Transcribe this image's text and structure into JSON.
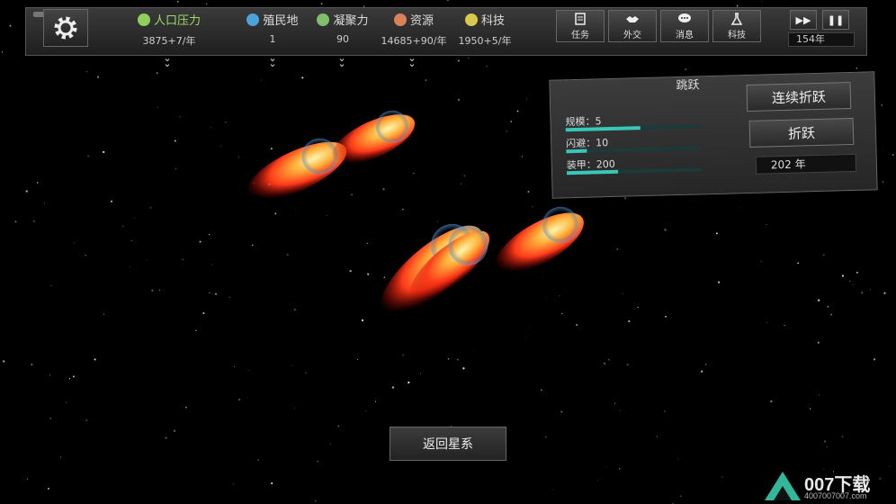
{
  "topbar": {
    "stats": [
      {
        "name": "population",
        "label": "人口压力",
        "value": "3875+7/年",
        "color": "#8fcf5a"
      },
      {
        "name": "colonies",
        "label": "殖民地",
        "value": "1",
        "color": "#4aa3d9"
      },
      {
        "name": "cohesion",
        "label": "凝聚力",
        "value": "90",
        "color": "#7fbf6a"
      },
      {
        "name": "resources",
        "label": "资源",
        "value": "14685+90/年",
        "color": "#d9825a"
      },
      {
        "name": "tech",
        "label": "科技",
        "value": "1950+5/年",
        "color": "#d9c94a"
      }
    ],
    "actions": [
      {
        "name": "tasks",
        "label": "任务"
      },
      {
        "name": "diplomacy",
        "label": "外交"
      },
      {
        "name": "messages",
        "label": "消息"
      },
      {
        "name": "tech",
        "label": "科技"
      }
    ],
    "controls": {
      "fast_forward": "▶▶",
      "pause": "❚❚"
    },
    "year": "154年"
  },
  "warp": {
    "title": "跳跃",
    "stats": [
      {
        "label": "规模：5",
        "fill": 0.55
      },
      {
        "label": "闪避：10",
        "fill": 0.15
      },
      {
        "label": "装甲：200",
        "fill": 0.38
      }
    ],
    "continuous_label": "连续折跃",
    "warp_label": "折跃",
    "year": "202 年"
  },
  "return_label": "返回星系",
  "watermark": {
    "brand": "007下载",
    "url": "4007007007.com"
  }
}
